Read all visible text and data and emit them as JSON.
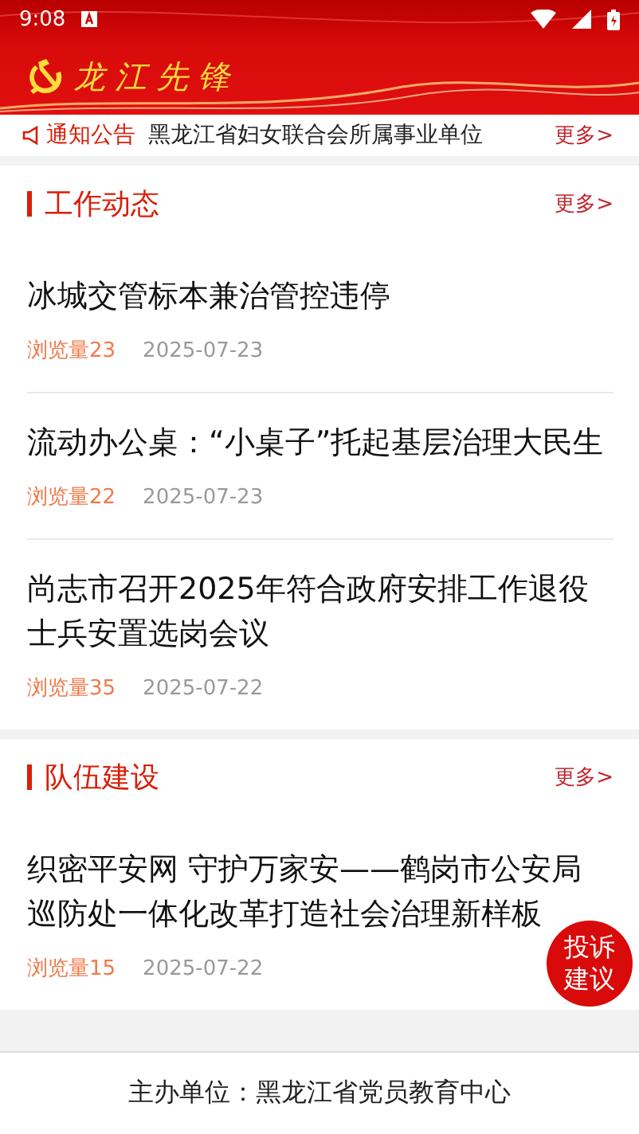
{
  "status_bar": {
    "time": "9:08"
  },
  "header": {
    "title": "龙江先锋"
  },
  "notice": {
    "label": "通知公告",
    "text": "黑龙江省妇女联合会所属事业单位",
    "more": "更多>"
  },
  "sections": [
    {
      "title": "工作动态",
      "more": "更多>",
      "items": [
        {
          "title": "冰城交管标本兼治管控违停",
          "views": "浏览量23",
          "date": "2025-07-23"
        },
        {
          "title": "流动办公桌：“小桌子”托起基层治理大民生",
          "views": "浏览量22",
          "date": "2025-07-23"
        },
        {
          "title": "尚志市召开2025年符合政府安排工作退役士兵安置选岗会议",
          "views": "浏览量35",
          "date": "2025-07-22"
        }
      ]
    },
    {
      "title": "队伍建设",
      "more": "更多>",
      "items": [
        {
          "title": "织密平安网 守护万家安——鹤岗市公安局巡防处一体化改革打造社会治理新样板",
          "views": "浏览量15",
          "date": "2025-07-22"
        }
      ]
    }
  ],
  "float_button": {
    "label": "投诉建议"
  },
  "footer": {
    "text": "主办单位：黑龙江省党员教育中心"
  }
}
